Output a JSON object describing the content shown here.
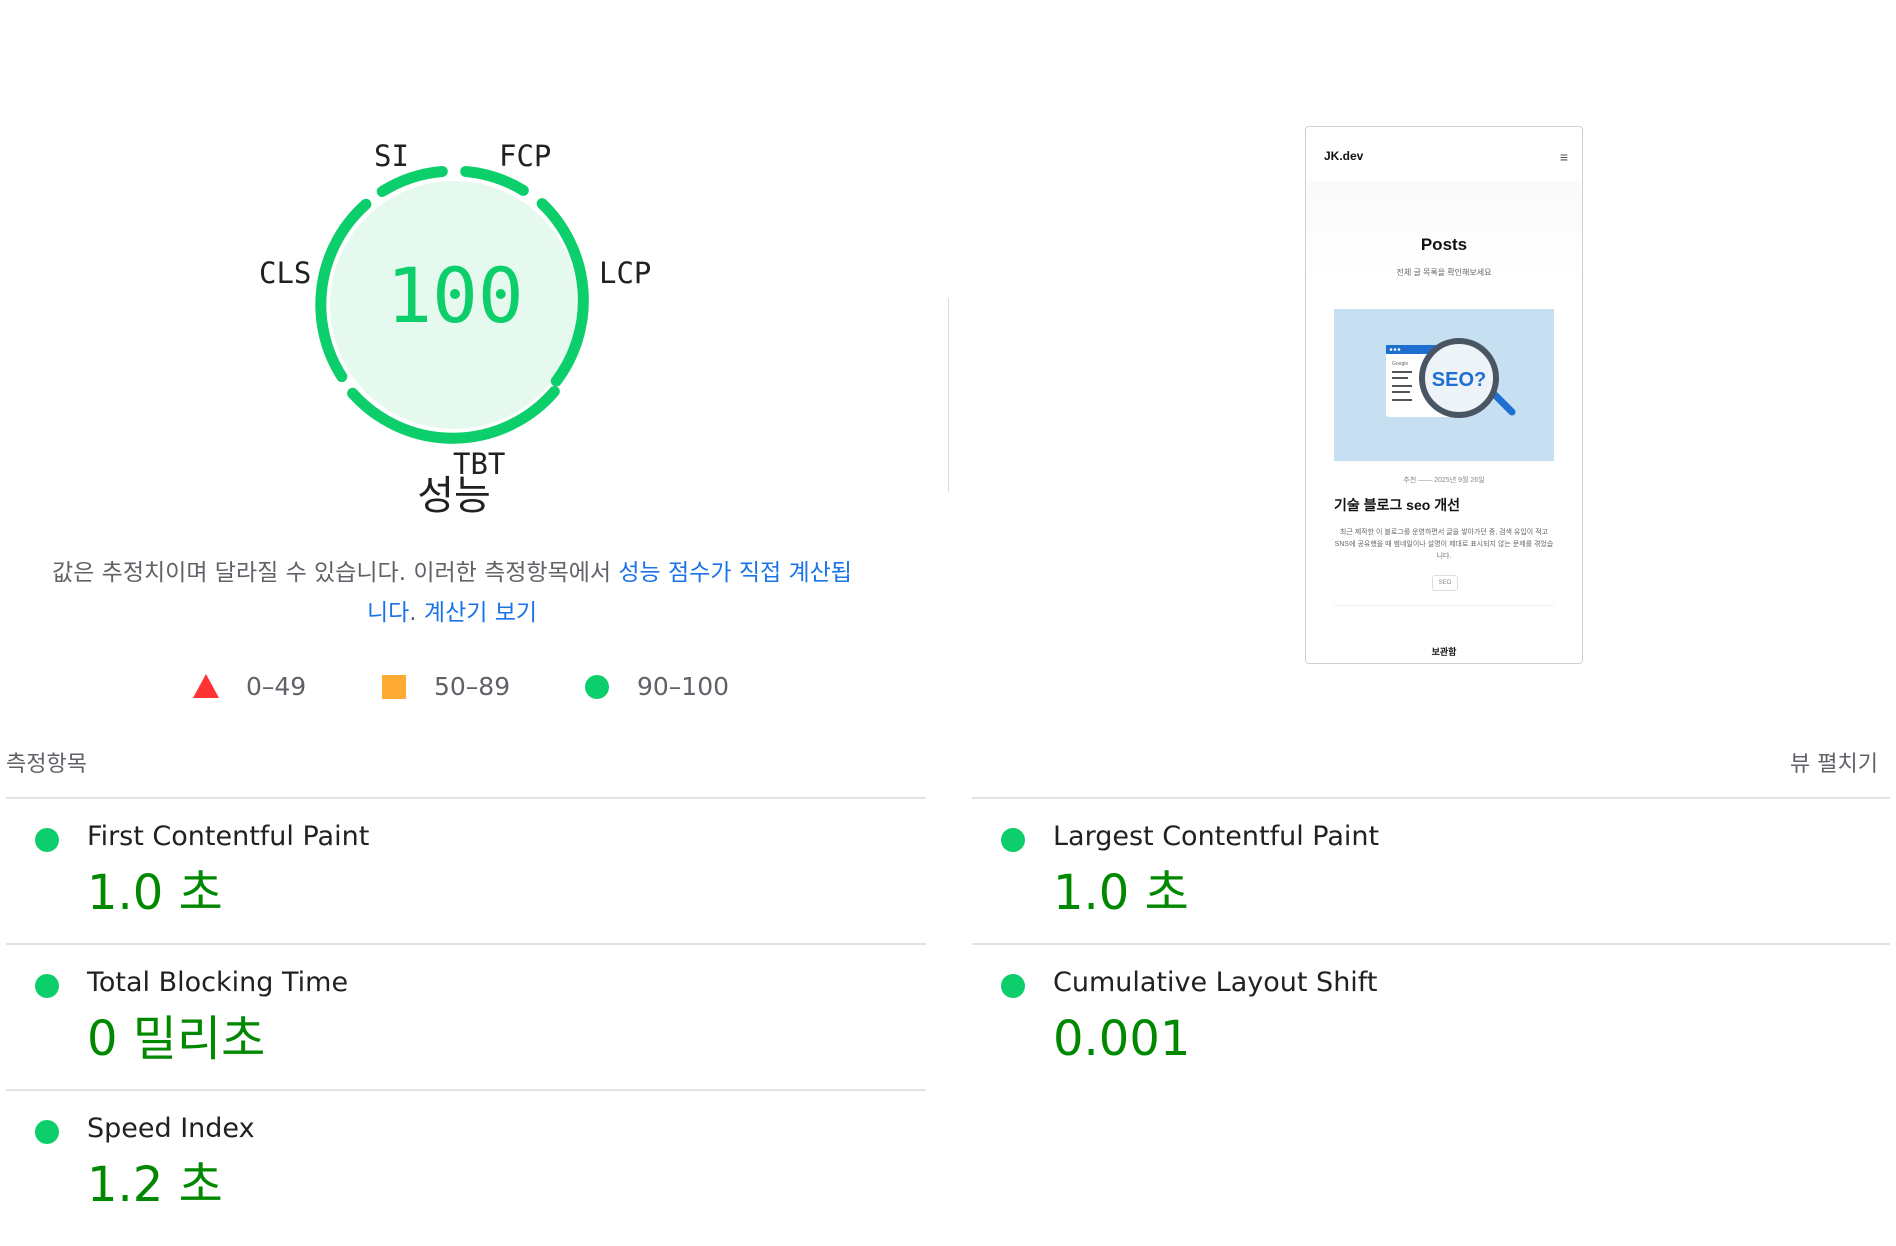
{
  "gauge": {
    "score": "100",
    "category": "성능",
    "labels": {
      "si": "SI",
      "fcp": "FCP",
      "lcp": "LCP",
      "tbt": "TBT",
      "cls": "CLS"
    },
    "color": "#0cce6b"
  },
  "description": {
    "text": "값은 추정치이며 달라질 수 있습니다. 이러한 측정항목에서 ",
    "link1": "성능 점수가 직접 계산됩니다",
    "sep": ". ",
    "link2": "계산기 보기"
  },
  "legend": [
    {
      "range": "0–49",
      "shape": "triangle",
      "color": "#ff3333"
    },
    {
      "range": "50–89",
      "shape": "square",
      "color": "#ffaa33"
    },
    {
      "range": "90–100",
      "shape": "circle",
      "color": "#0cce6b"
    }
  ],
  "screenshot": {
    "brand": "JK.dev",
    "menu_icon": "≡",
    "heading": "Posts",
    "subheading": "전체 글 목록을 확인해보세요",
    "badge_text": "SEO?",
    "google_label": "Google",
    "meta": "추천 —— 2025년 9월 26일",
    "post_title": "기술 블로그 seo 개선",
    "excerpt": "최근 제작한 이 블로그를 운영하면서 글을 쌓아가던 중, 검색 유입이 적고 SNS에 공유했을 때 썸네일이나 설명이 제대로 표시되지 않는 문제를 겪었습니다.",
    "tag": "SEO",
    "footer": "보관함"
  },
  "metrics": {
    "header": "측정항목",
    "expand_label": "뷰 펼치기",
    "items": [
      {
        "name": "First Contentful Paint",
        "value": "1.0 초"
      },
      {
        "name": "Largest Contentful Paint",
        "value": "1.0 초"
      },
      {
        "name": "Total Blocking Time",
        "value": "0 밀리초"
      },
      {
        "name": "Cumulative Layout Shift",
        "value": "0.001"
      },
      {
        "name": "Speed Index",
        "value": "1.2 초"
      }
    ]
  }
}
